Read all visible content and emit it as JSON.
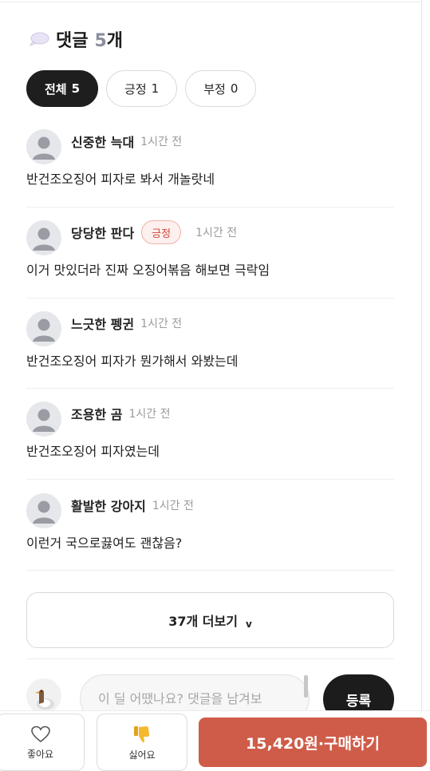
{
  "header": {
    "icon": "speech-bubble-icon",
    "title": "댓글",
    "count": "5",
    "unit": "개"
  },
  "filters": [
    {
      "label": "전체",
      "count": "5",
      "active": true
    },
    {
      "label": "긍정",
      "count": "1",
      "active": false
    },
    {
      "label": "부정",
      "count": "0",
      "active": false
    }
  ],
  "comments": [
    {
      "author": "신중한 늑대",
      "time": "1시간 전",
      "badge": "",
      "text": "반건조오징어 피자로 봐서 개놀랏네"
    },
    {
      "author": "당당한 판다",
      "time": "1시간 전",
      "badge": "긍정",
      "text": "이거 맛있더라 진짜 오징어볶음 해보면 극락임"
    },
    {
      "author": "느긋한 펭귄",
      "time": "1시간 전",
      "badge": "",
      "text": "반건조오징어 피자가 뭔가해서 와봤는데"
    },
    {
      "author": "조용한 곰",
      "time": "1시간 전",
      "badge": "",
      "text": "반건조오징어 피자였는데"
    },
    {
      "author": "활발한 강아지",
      "time": "1시간 전",
      "badge": "",
      "text": "이런거 국으로끓여도 괜찮음?"
    }
  ],
  "more": {
    "label": "37개 더보기",
    "chevron": "v"
  },
  "input": {
    "placeholder": "이 딜 어땠나요? 댓글을 남겨보",
    "submit_label": "등록"
  },
  "bottom": {
    "like_label": "좋아요",
    "dislike_label": "싫어요",
    "buy_label": "15,420원·구매하기"
  },
  "colors": {
    "accent": "#cf5c48",
    "dark": "#1e1e1e",
    "badge_text": "#d0493b",
    "badge_bg": "#fdf0ee"
  }
}
